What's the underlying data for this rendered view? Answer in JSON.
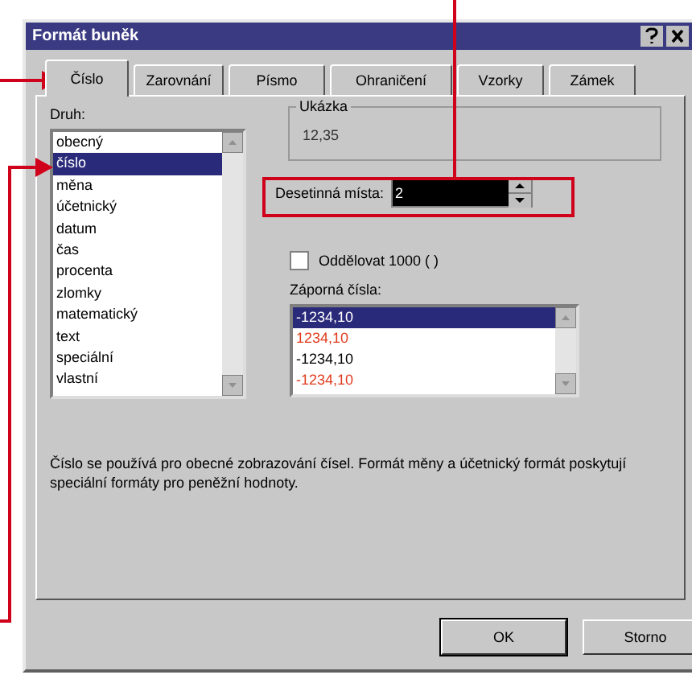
{
  "window": {
    "title": "Formát buněk"
  },
  "tabs": [
    {
      "label": "Číslo",
      "selected": true
    },
    {
      "label": "Zarovnání",
      "selected": false
    },
    {
      "label": "Písmo",
      "selected": false
    },
    {
      "label": "Ohraničení",
      "selected": false
    },
    {
      "label": "Vzorky",
      "selected": false
    },
    {
      "label": "Zámek",
      "selected": false
    }
  ],
  "category": {
    "label": "Druh:",
    "items": [
      {
        "label": "obecný",
        "selected": false
      },
      {
        "label": "číslo",
        "selected": true
      },
      {
        "label": "měna",
        "selected": false
      },
      {
        "label": "účetnický",
        "selected": false
      },
      {
        "label": "datum",
        "selected": false
      },
      {
        "label": "čas",
        "selected": false
      },
      {
        "label": "procenta",
        "selected": false
      },
      {
        "label": "zlomky",
        "selected": false
      },
      {
        "label": "matematický",
        "selected": false
      },
      {
        "label": "text",
        "selected": false
      },
      {
        "label": "speciální",
        "selected": false
      },
      {
        "label": "vlastní",
        "selected": false
      }
    ]
  },
  "sample": {
    "label": "Ukázka",
    "value": "12,35"
  },
  "decimals": {
    "label": "Desetinná místa:",
    "value": "2"
  },
  "thousands": {
    "label": "Oddělovat 1000 ( )",
    "checked": false
  },
  "negative": {
    "label": "Záporná čísla:",
    "items": [
      {
        "label": "-1234,10",
        "selected": true
      },
      {
        "label": "1234,10",
        "selected": false,
        "color": "#e03c1e"
      },
      {
        "label": "-1234,10",
        "selected": false,
        "color": "#000000"
      },
      {
        "label": "-1234,10",
        "selected": false,
        "color": "#e03c1e"
      }
    ]
  },
  "description": "Číslo se používá pro obecné zobrazování čísel. Formát měny a účetnický formát poskytují speciální formáty pro peněžní hodnoty.",
  "buttons": [
    "OK",
    "Storno"
  ]
}
